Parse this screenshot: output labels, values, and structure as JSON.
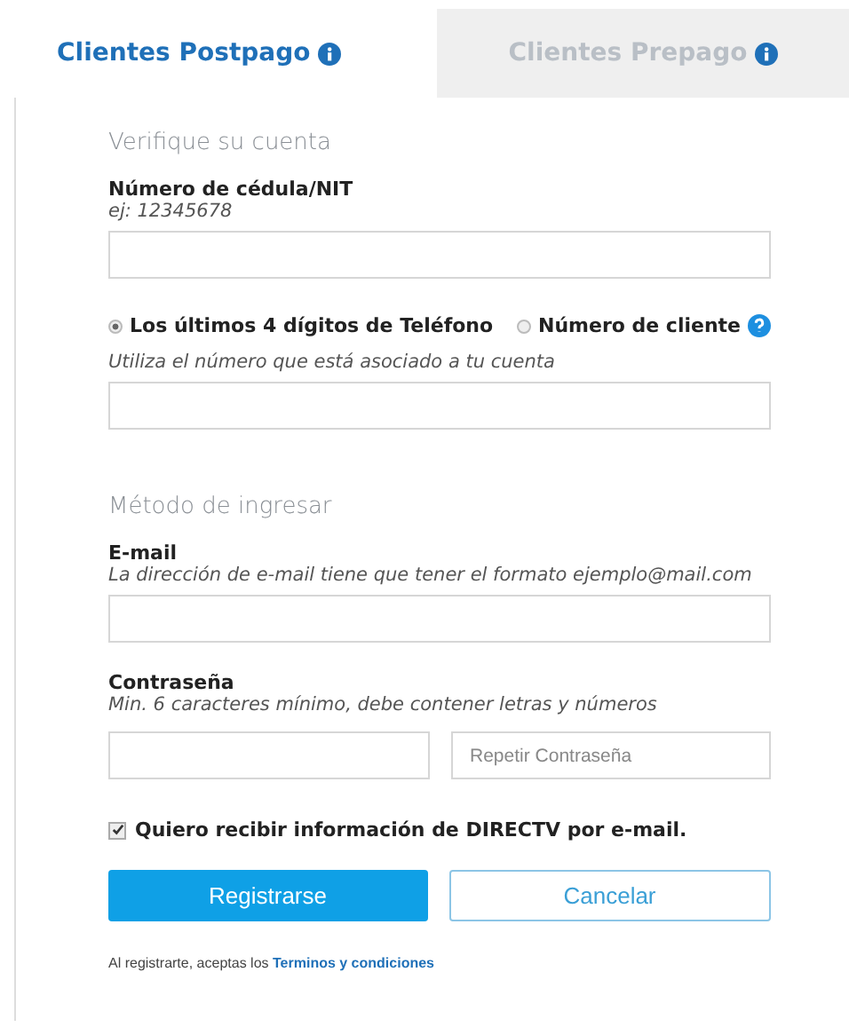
{
  "tabs": [
    {
      "label": "Clientes Postpago",
      "selected": true
    },
    {
      "label": "Clientes Prepago",
      "selected": false
    }
  ],
  "verify": {
    "heading": "Verifique su cuenta",
    "id_label": "Número de cédula/NIT",
    "id_hint": "ej: 12345678",
    "options": [
      {
        "label": "Los últimos 4 dígitos de Teléfono",
        "selected": true,
        "help": false
      },
      {
        "label": "Número de cliente",
        "selected": false,
        "help": true
      }
    ],
    "option_hint": "Utiliza el número que está asociado a tu cuenta"
  },
  "login": {
    "heading": "Método de ingresar",
    "email_label": "E-mail",
    "email_hint": "La dirección de e-mail tiene que tener el formato ejemplo@mail.com",
    "password_label": "Contraseña",
    "password_hint": "Min. 6 caracteres mínimo, debe contener letras y números",
    "repeat_placeholder": "Repetir Contraseña"
  },
  "newsletter": {
    "label": "Quiero recibir información de DIRECTV por e-mail.",
    "checked": true
  },
  "buttons": [
    {
      "label": "Registrarse",
      "kind": "primary"
    },
    {
      "label": "Cancelar",
      "kind": "secondary"
    }
  ],
  "footer": {
    "text": "Al registrarte, aceptas los",
    "link": "Terminos y condiciones"
  }
}
